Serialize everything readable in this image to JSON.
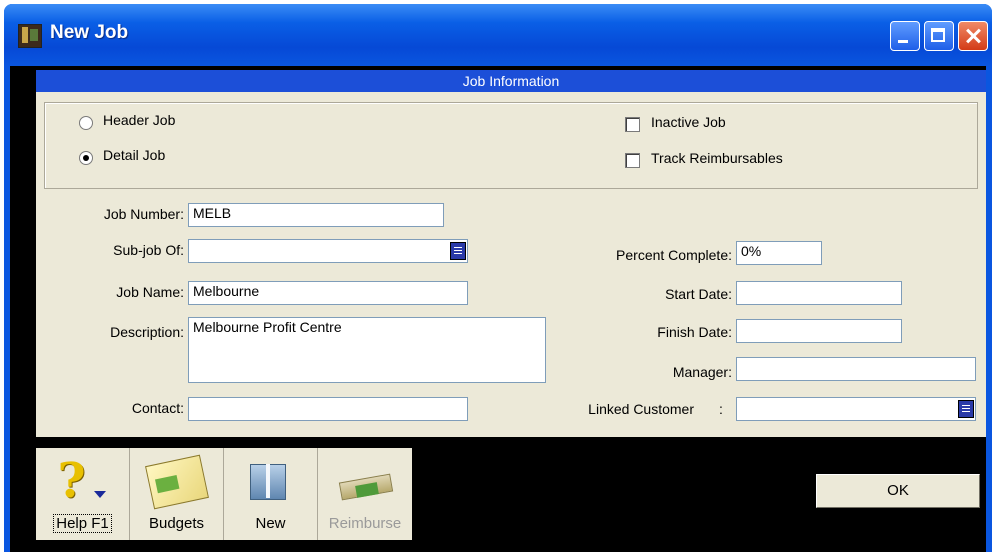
{
  "window": {
    "title": "New Job"
  },
  "section": {
    "title": "Job Information"
  },
  "job_type": {
    "header_label": "Header Job",
    "detail_label": "Detail Job",
    "selected": "detail"
  },
  "flags": {
    "inactive_label": "Inactive Job",
    "inactive_checked": false,
    "track_label": "Track Reimbursables",
    "track_checked": false
  },
  "fields": {
    "job_number": {
      "label": "Job Number:",
      "value": "MELB"
    },
    "sub_job_of": {
      "label": "Sub-job Of:",
      "value": ""
    },
    "job_name": {
      "label": "Job Name:",
      "value": "Melbourne"
    },
    "description": {
      "label": "Description:",
      "value": "Melbourne Profit Centre"
    },
    "contact": {
      "label": "Contact:",
      "value": ""
    },
    "percent_complete": {
      "label": "Percent Complete:",
      "value": "0%"
    },
    "start_date": {
      "label": "Start Date:",
      "value": ""
    },
    "finish_date": {
      "label": "Finish Date:",
      "value": ""
    },
    "manager": {
      "label": "Manager:",
      "value": ""
    },
    "linked_customer": {
      "label": "Linked Customer",
      "colon": ":",
      "value": ""
    }
  },
  "toolbar": {
    "help_label": "Help F1",
    "budgets_label": "Budgets",
    "new_label": "New",
    "reimburse_label": "Reimburse"
  },
  "buttons": {
    "ok_label": "OK"
  },
  "icons": {
    "app": "app-icon",
    "help": "question-mark-icon",
    "budgets": "budget-icon",
    "new": "new-job-icon",
    "reimburse": "reimburse-icon",
    "dropdown": "dropdown-icon"
  },
  "colors": {
    "header": "#1c4fd8",
    "panel": "#ece9d8",
    "titlebar": "#0a56e0"
  }
}
